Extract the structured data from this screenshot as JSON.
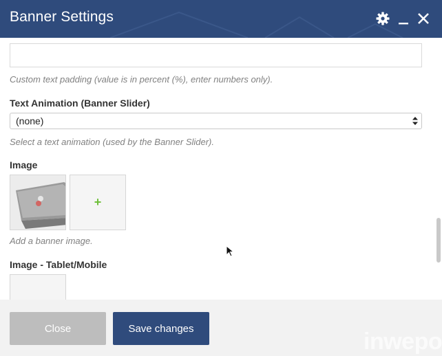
{
  "modal": {
    "title": "Banner Settings",
    "icons": {
      "settings": "gear-icon",
      "minimize": "minimize-icon",
      "close": "close-icon"
    }
  },
  "fields": {
    "text_padding": {
      "value": "",
      "help": "Custom text padding (value is in percent (%), enter numbers only)."
    },
    "text_animation": {
      "label": "Text Animation (Banner Slider)",
      "selected": "(none)",
      "help": "Select a text animation (used by the Banner Slider)."
    },
    "image": {
      "label": "Image",
      "add_symbol": "+",
      "help": "Add a banner image."
    },
    "image_mobile": {
      "label": "Image - Tablet/Mobile"
    }
  },
  "footer": {
    "close_label": "Close",
    "save_label": "Save changes"
  },
  "watermark": "inwepo",
  "colors": {
    "header": "#2f4b7c",
    "save_button": "#2f4b7c",
    "close_button": "#bdbdbd",
    "add_plus": "#6fbf3a",
    "help_text": "#808080"
  }
}
